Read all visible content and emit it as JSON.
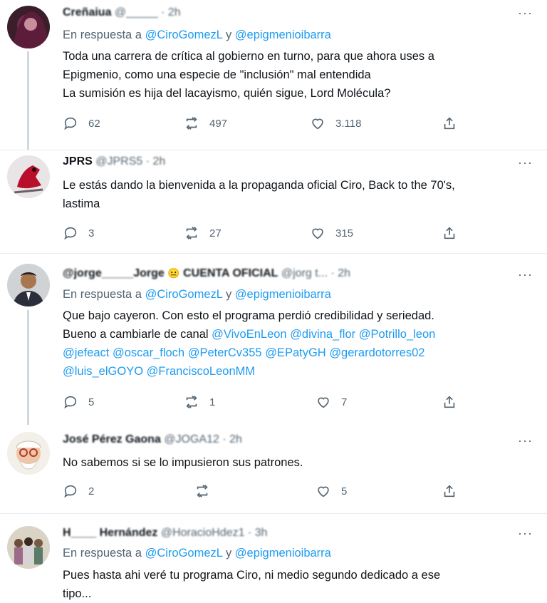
{
  "tweets": [
    {
      "display_name": "Creñaiua",
      "handle_meta": "@_____ · 2h",
      "reply_prefix": "En respuesta a",
      "reply_user1": "@CiroGomezL",
      "reply_join": "y",
      "reply_user2": "@epigmenioibarra",
      "lines": [
        "Toda una carrera de crítica al gobierno en turno, para que ahora uses a",
        "Epigmenio, como una especie de \"inclusión\" mal entendida",
        "La sumisión es hija del lacayismo, quién sigue, Lord Molécula?"
      ],
      "replies": "62",
      "retweets": "497",
      "likes": "3.118",
      "more": "···"
    },
    {
      "display_name": "JPRS",
      "handle_meta": "@JPRS5 · 2h",
      "lines": [
        "Le estás dando la bienvenida a la propaganda oficial Ciro, Back to the 70's,",
        "lastima"
      ],
      "replies": "3",
      "retweets": "27",
      "likes": "315",
      "more": "···"
    },
    {
      "display_name": "@jorge_____Jorge",
      "badge": "😐",
      "handle_prefix": "CUENTA OFICIAL",
      "handle_meta": "@jorg t... · 2h",
      "reply_prefix": "En respuesta a",
      "reply_user1": "@CiroGomezL",
      "reply_join": "y",
      "reply_user2": "@epigmenioibarra",
      "line1": "Que bajo cayeron. Con esto el programa perdió credibilidad y seriedad.",
      "line2_text": "Bueno a cambiarle de canal",
      "mentions_line2": [
        "@VivoEnLeon",
        "@divina_flor",
        "@Potrillo_leon"
      ],
      "mentions_line3": [
        "@jefeact",
        "@oscar_floch",
        "@PeterCv355",
        "@EPatyGH",
        "@gerardotorres02"
      ],
      "mentions_line4": [
        "@luis_elGOYO",
        "@FranciscoLeonMM"
      ],
      "replies": "5",
      "retweets": "1",
      "likes": "7",
      "more": "···"
    },
    {
      "display_name": "José Pérez Gaona",
      "handle_meta": "@JOGA12 · 2h",
      "lines": [
        "No sabemos si se lo impusieron sus patrones."
      ],
      "replies": "2",
      "retweets": "",
      "likes": "5",
      "more": "···"
    },
    {
      "display_name": "H____ Hernández",
      "handle_meta": "@HoracioHdez1 · 3h",
      "reply_prefix": "En respuesta a",
      "reply_user1": "@CiroGomezL",
      "reply_join": "y",
      "reply_user2": "@epigmenioibarra",
      "lines": [
        "Pues hasta ahi veré tu programa Ciro, ni medio segundo dedicado a ese",
        "tipo..."
      ],
      "more": "···"
    }
  ],
  "icons": {
    "reply": "reply-icon",
    "retweet": "retweet-icon",
    "like": "heart-icon",
    "share": "share-icon",
    "more": "more-icon"
  },
  "colors": {
    "link": "#1d9bf0",
    "muted": "#536471",
    "divider": "#e6ecf0",
    "thread": "#cfd9de"
  }
}
